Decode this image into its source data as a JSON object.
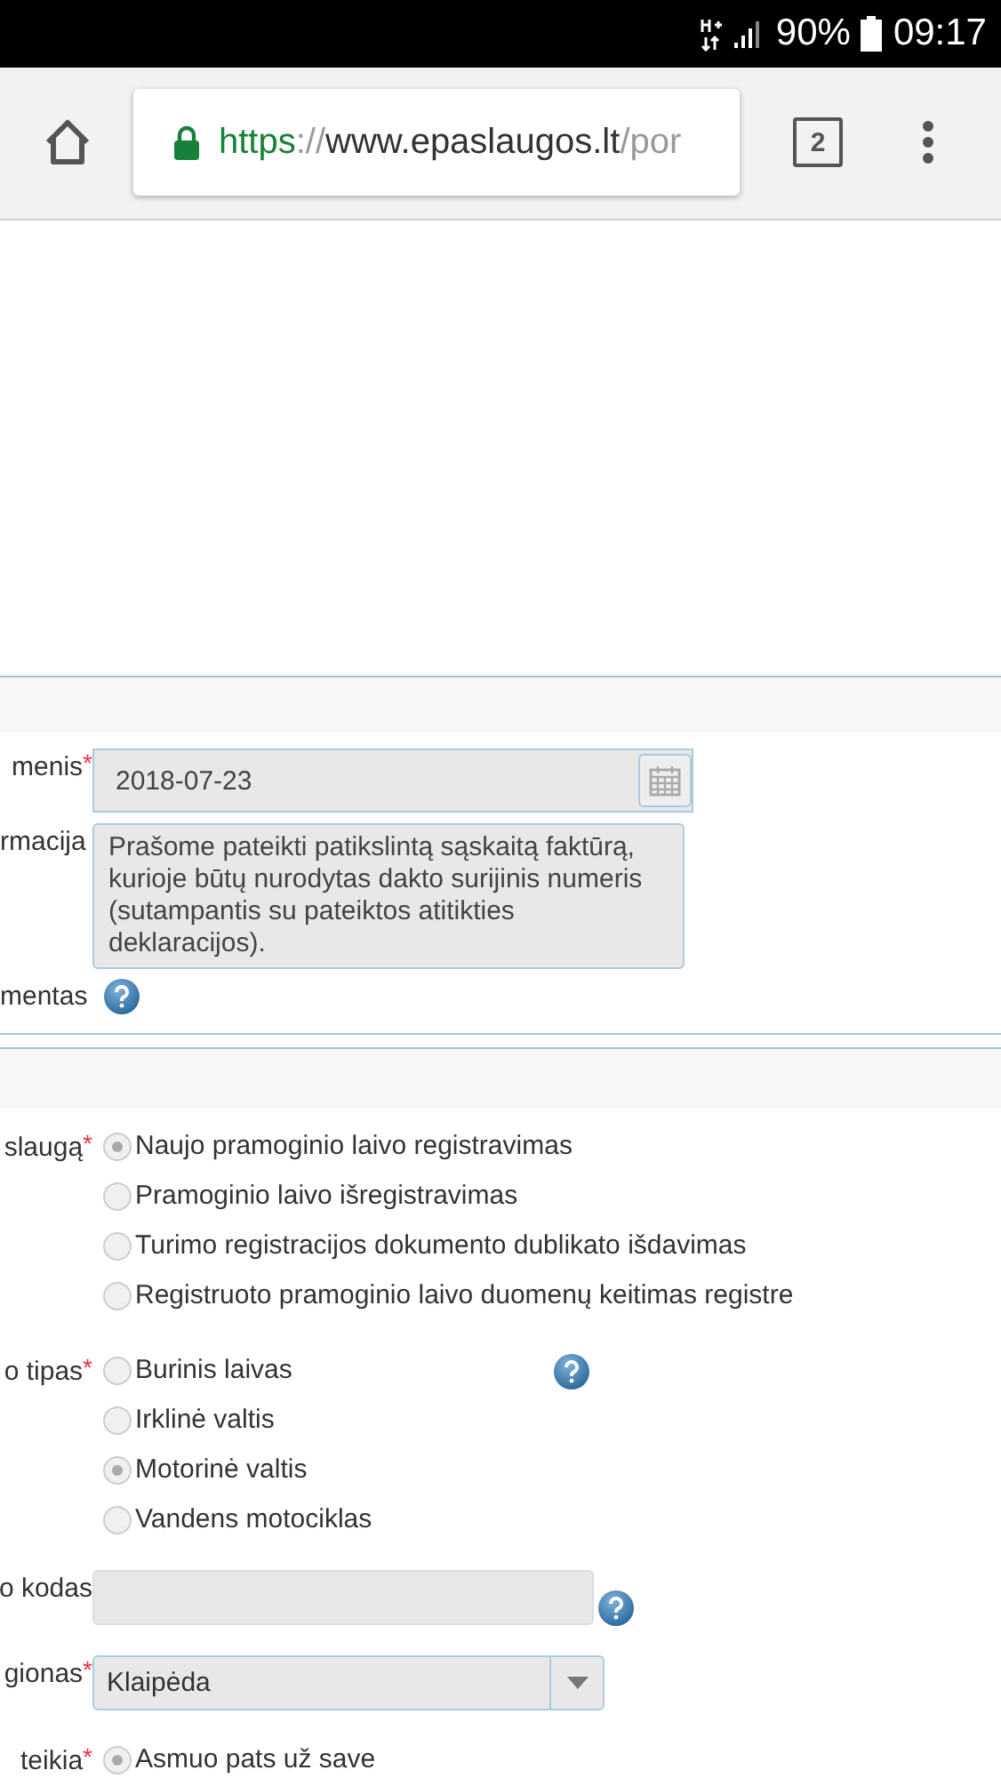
{
  "status_bar": {
    "battery": "90%",
    "time": "09:17"
  },
  "browser": {
    "url_scheme": "https",
    "url_separator": "://",
    "url_host": "www.epaslaugos.lt",
    "url_path": "/por",
    "tab_count": "2"
  },
  "form": {
    "date": {
      "label": "menis",
      "required_mark": "*",
      "value": "2018-07-23"
    },
    "info": {
      "label": "rmacija",
      "value": "Prašome pateikti patikslintą sąskaitą faktūrą, kurioje būtų nurodytas dakto surijinis numeris (sutampantis su pateiktos atitikties deklaracijos)."
    },
    "document": {
      "label": "mentas"
    },
    "service": {
      "label": "slaugą",
      "required_mark": "*",
      "options": [
        {
          "label": "Naujo pramoginio laivo registravimas",
          "selected": true
        },
        {
          "label": "Pramoginio laivo išregistravimas",
          "selected": false
        },
        {
          "label": "Turimo registracijos dokumento dublikato išdavimas",
          "selected": false
        },
        {
          "label": "Registruoto pramoginio laivo duomenų keitimas registre",
          "selected": false
        }
      ]
    },
    "type": {
      "label": "o tipas",
      "required_mark": "*",
      "options": [
        {
          "label": "Burinis laivas",
          "selected": false
        },
        {
          "label": "Irklinė valtis",
          "selected": false
        },
        {
          "label": "Motorinė valtis",
          "selected": true
        },
        {
          "label": "Vandens motociklas",
          "selected": false
        }
      ]
    },
    "code": {
      "label": "o kodas"
    },
    "region": {
      "label": "gionas",
      "required_mark": "*",
      "value": "Klaipėda"
    },
    "submitter": {
      "label": "teikia",
      "required_mark": "*",
      "options": [
        {
          "label": "Asmuo pats už save",
          "selected": true
        }
      ]
    }
  }
}
